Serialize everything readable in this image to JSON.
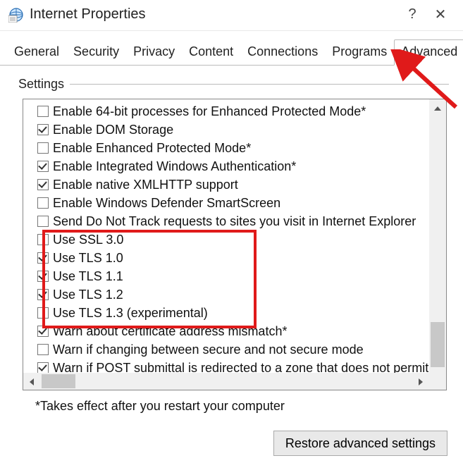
{
  "window": {
    "title": "Internet Properties",
    "help": "?",
    "close": "✕"
  },
  "tabs": [
    "General",
    "Security",
    "Privacy",
    "Content",
    "Connections",
    "Programs",
    "Advanced"
  ],
  "active_tab": "Advanced",
  "settings_label": "Settings",
  "options": [
    {
      "label": "Enable 64-bit processes for Enhanced Protected Mode*",
      "checked": false
    },
    {
      "label": "Enable DOM Storage",
      "checked": true
    },
    {
      "label": "Enable Enhanced Protected Mode*",
      "checked": false
    },
    {
      "label": "Enable Integrated Windows Authentication*",
      "checked": true
    },
    {
      "label": "Enable native XMLHTTP support",
      "checked": true
    },
    {
      "label": "Enable Windows Defender SmartScreen",
      "checked": false
    },
    {
      "label": "Send Do Not Track requests to sites you visit in Internet Explorer",
      "checked": false
    },
    {
      "label": "Use SSL 3.0",
      "checked": false
    },
    {
      "label": "Use TLS 1.0",
      "checked": true
    },
    {
      "label": "Use TLS 1.1",
      "checked": true
    },
    {
      "label": "Use TLS 1.2",
      "checked": true
    },
    {
      "label": "Use TLS 1.3 (experimental)",
      "checked": false
    },
    {
      "label": "Warn about certificate address mismatch*",
      "checked": true
    },
    {
      "label": "Warn if changing between secure and not secure mode",
      "checked": false
    },
    {
      "label": "Warn if POST submittal is redirected to a zone that does not permit posts",
      "checked": true
    }
  ],
  "footnote": "*Takes effect after you restart your computer",
  "restore_button": "Restore advanced settings",
  "annotation": {
    "arrow_color": "#e01a1a",
    "highlight_color": "#e01a1a"
  }
}
